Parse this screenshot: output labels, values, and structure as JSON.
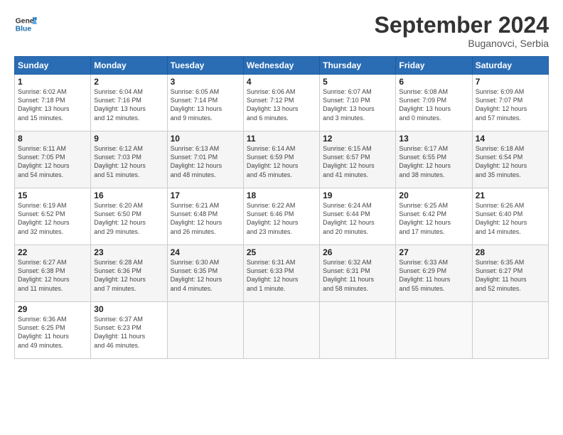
{
  "header": {
    "logo_line1": "General",
    "logo_line2": "Blue",
    "month": "September 2024",
    "location": "Buganovci, Serbia"
  },
  "weekdays": [
    "Sunday",
    "Monday",
    "Tuesday",
    "Wednesday",
    "Thursday",
    "Friday",
    "Saturday"
  ],
  "weeks": [
    [
      {
        "day": "1",
        "info": "Sunrise: 6:02 AM\nSunset: 7:18 PM\nDaylight: 13 hours\nand 15 minutes."
      },
      {
        "day": "2",
        "info": "Sunrise: 6:04 AM\nSunset: 7:16 PM\nDaylight: 13 hours\nand 12 minutes."
      },
      {
        "day": "3",
        "info": "Sunrise: 6:05 AM\nSunset: 7:14 PM\nDaylight: 13 hours\nand 9 minutes."
      },
      {
        "day": "4",
        "info": "Sunrise: 6:06 AM\nSunset: 7:12 PM\nDaylight: 13 hours\nand 6 minutes."
      },
      {
        "day": "5",
        "info": "Sunrise: 6:07 AM\nSunset: 7:10 PM\nDaylight: 13 hours\nand 3 minutes."
      },
      {
        "day": "6",
        "info": "Sunrise: 6:08 AM\nSunset: 7:09 PM\nDaylight: 13 hours\nand 0 minutes."
      },
      {
        "day": "7",
        "info": "Sunrise: 6:09 AM\nSunset: 7:07 PM\nDaylight: 12 hours\nand 57 minutes."
      }
    ],
    [
      {
        "day": "8",
        "info": "Sunrise: 6:11 AM\nSunset: 7:05 PM\nDaylight: 12 hours\nand 54 minutes."
      },
      {
        "day": "9",
        "info": "Sunrise: 6:12 AM\nSunset: 7:03 PM\nDaylight: 12 hours\nand 51 minutes."
      },
      {
        "day": "10",
        "info": "Sunrise: 6:13 AM\nSunset: 7:01 PM\nDaylight: 12 hours\nand 48 minutes."
      },
      {
        "day": "11",
        "info": "Sunrise: 6:14 AM\nSunset: 6:59 PM\nDaylight: 12 hours\nand 45 minutes."
      },
      {
        "day": "12",
        "info": "Sunrise: 6:15 AM\nSunset: 6:57 PM\nDaylight: 12 hours\nand 41 minutes."
      },
      {
        "day": "13",
        "info": "Sunrise: 6:17 AM\nSunset: 6:55 PM\nDaylight: 12 hours\nand 38 minutes."
      },
      {
        "day": "14",
        "info": "Sunrise: 6:18 AM\nSunset: 6:54 PM\nDaylight: 12 hours\nand 35 minutes."
      }
    ],
    [
      {
        "day": "15",
        "info": "Sunrise: 6:19 AM\nSunset: 6:52 PM\nDaylight: 12 hours\nand 32 minutes."
      },
      {
        "day": "16",
        "info": "Sunrise: 6:20 AM\nSunset: 6:50 PM\nDaylight: 12 hours\nand 29 minutes."
      },
      {
        "day": "17",
        "info": "Sunrise: 6:21 AM\nSunset: 6:48 PM\nDaylight: 12 hours\nand 26 minutes."
      },
      {
        "day": "18",
        "info": "Sunrise: 6:22 AM\nSunset: 6:46 PM\nDaylight: 12 hours\nand 23 minutes."
      },
      {
        "day": "19",
        "info": "Sunrise: 6:24 AM\nSunset: 6:44 PM\nDaylight: 12 hours\nand 20 minutes."
      },
      {
        "day": "20",
        "info": "Sunrise: 6:25 AM\nSunset: 6:42 PM\nDaylight: 12 hours\nand 17 minutes."
      },
      {
        "day": "21",
        "info": "Sunrise: 6:26 AM\nSunset: 6:40 PM\nDaylight: 12 hours\nand 14 minutes."
      }
    ],
    [
      {
        "day": "22",
        "info": "Sunrise: 6:27 AM\nSunset: 6:38 PM\nDaylight: 12 hours\nand 11 minutes."
      },
      {
        "day": "23",
        "info": "Sunrise: 6:28 AM\nSunset: 6:36 PM\nDaylight: 12 hours\nand 7 minutes."
      },
      {
        "day": "24",
        "info": "Sunrise: 6:30 AM\nSunset: 6:35 PM\nDaylight: 12 hours\nand 4 minutes."
      },
      {
        "day": "25",
        "info": "Sunrise: 6:31 AM\nSunset: 6:33 PM\nDaylight: 12 hours\nand 1 minute."
      },
      {
        "day": "26",
        "info": "Sunrise: 6:32 AM\nSunset: 6:31 PM\nDaylight: 11 hours\nand 58 minutes."
      },
      {
        "day": "27",
        "info": "Sunrise: 6:33 AM\nSunset: 6:29 PM\nDaylight: 11 hours\nand 55 minutes."
      },
      {
        "day": "28",
        "info": "Sunrise: 6:35 AM\nSunset: 6:27 PM\nDaylight: 11 hours\nand 52 minutes."
      }
    ],
    [
      {
        "day": "29",
        "info": "Sunrise: 6:36 AM\nSunset: 6:25 PM\nDaylight: 11 hours\nand 49 minutes."
      },
      {
        "day": "30",
        "info": "Sunrise: 6:37 AM\nSunset: 6:23 PM\nDaylight: 11 hours\nand 46 minutes."
      },
      {
        "day": "",
        "info": ""
      },
      {
        "day": "",
        "info": ""
      },
      {
        "day": "",
        "info": ""
      },
      {
        "day": "",
        "info": ""
      },
      {
        "day": "",
        "info": ""
      }
    ]
  ]
}
